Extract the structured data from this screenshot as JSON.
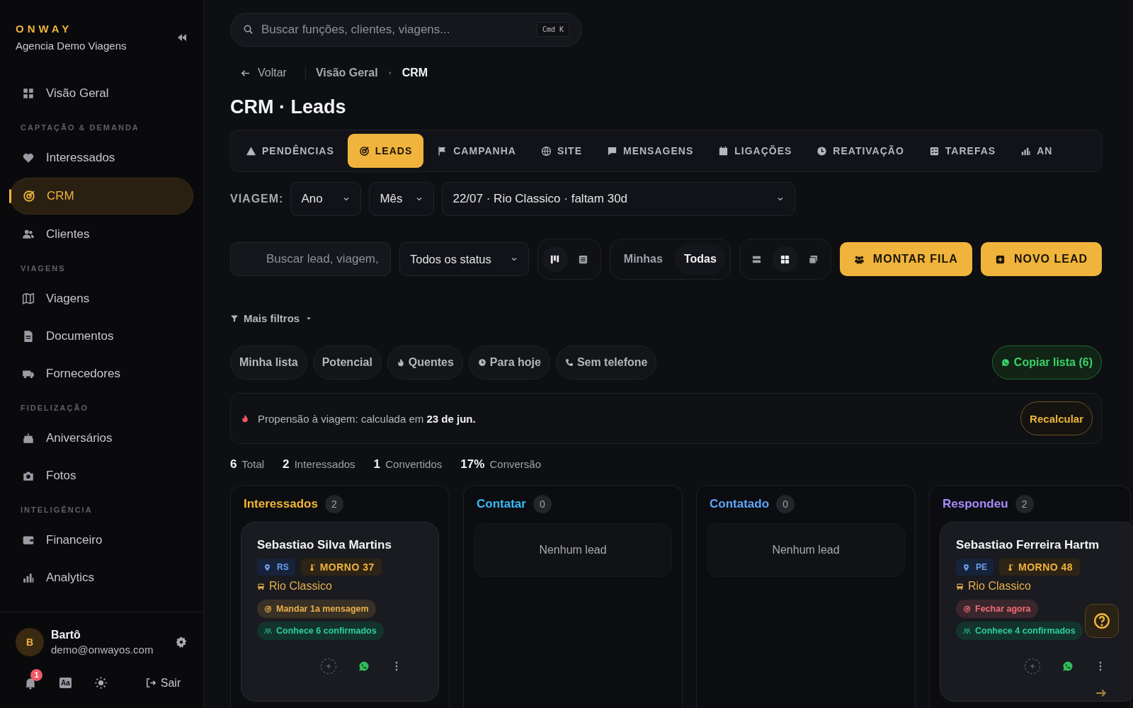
{
  "sidebar": {
    "brand": "ONWAY",
    "subtitle": "Agencia Demo Viagens",
    "nav": [
      {
        "kind": "item",
        "label": "Visão Geral",
        "selected": false
      },
      {
        "kind": "section",
        "label": "CAPTAÇÃO & DEMANDA"
      },
      {
        "kind": "item",
        "label": "Interessados",
        "selected": false
      },
      {
        "kind": "item",
        "label": "CRM",
        "selected": true
      },
      {
        "kind": "item",
        "label": "Clientes",
        "selected": false
      },
      {
        "kind": "section",
        "label": "VIAGENS"
      },
      {
        "kind": "item",
        "label": "Viagens",
        "selected": false
      },
      {
        "kind": "item",
        "label": "Documentos",
        "selected": false
      },
      {
        "kind": "item",
        "label": "Fornecedores",
        "selected": false
      },
      {
        "kind": "section",
        "label": "FIDELIZAÇÃO"
      },
      {
        "kind": "item",
        "label": "Aniversários",
        "selected": false
      },
      {
        "kind": "item",
        "label": "Fotos",
        "selected": false
      },
      {
        "kind": "section",
        "label": "INTELIGÊNCIA"
      },
      {
        "kind": "item",
        "label": "Financeiro",
        "selected": false
      },
      {
        "kind": "item",
        "label": "Analytics",
        "selected": false
      }
    ],
    "user": {
      "initial": "B",
      "name": "Bartô",
      "email": "demo@onwayos.com"
    },
    "notifications": "1",
    "font_button": "Aa",
    "logout": "Sair"
  },
  "search": {
    "placeholder": "Buscar funções, clientes, viagens...",
    "shortcut": "Cmd K"
  },
  "breadcrumb": {
    "back": "Voltar",
    "items": [
      "Visão Geral",
      "CRM"
    ]
  },
  "title": "CRM · Leads",
  "tabs": [
    {
      "label": "PENDÊNCIAS",
      "selected": false
    },
    {
      "label": "LEADS",
      "selected": true
    },
    {
      "label": "CAMPANHA",
      "selected": false
    },
    {
      "label": "SITE",
      "selected": false
    },
    {
      "label": "MENSAGENS",
      "selected": false
    },
    {
      "label": "LIGAÇÕES",
      "selected": false
    },
    {
      "label": "REATIVAÇÃO",
      "selected": false
    },
    {
      "label": "TAREFAS",
      "selected": false
    },
    {
      "label": "AN",
      "selected": false
    }
  ],
  "trip_filter": {
    "label": "VIAGEM:",
    "year": "Ano",
    "month": "Mês",
    "trip": "22/07 · Rio Classico · faltam 30d"
  },
  "toolbar": {
    "search_placeholder": "Buscar lead, viagem,",
    "status": "Todos os status",
    "view_modes": [
      {
        "selected": true
      },
      {
        "selected": false
      }
    ],
    "owners": [
      {
        "label": "Minhas",
        "selected": false
      },
      {
        "label": "Todas",
        "selected": true
      }
    ],
    "densities": [
      {
        "selected": false
      },
      {
        "selected": true
      },
      {
        "selected": false
      }
    ],
    "buttons": [
      "MONTAR FILA",
      "NOVO LEAD"
    ]
  },
  "more_filters": "Mais filtros",
  "chips": [
    {
      "label": "Minha lista",
      "selected": false
    },
    {
      "label": "Potencial",
      "selected": false
    },
    {
      "label": "Quentes",
      "selected": false
    },
    {
      "label": "Para hoje",
      "selected": false
    },
    {
      "label": "Sem telefone",
      "selected": false
    }
  ],
  "copy_list": "Copiar lista (6)",
  "propensity": {
    "text": "Propensão à viagem: calculada em **23 de jun.**",
    "button": "Recalcular"
  },
  "stats": [
    "**6** Total",
    "**2** Interessados",
    "**1** Convertidos",
    "**17%** Conversão"
  ],
  "columns": [
    {
      "title": "Interessados",
      "color": "#f5b731",
      "count": "2",
      "cards": [
        {
          "name": "Sebastiao Silva Martins",
          "state": "RS",
          "temperature": "MORNO 37",
          "trip": "Rio Classico",
          "action": {
            "text": "Mandar 1a mensagem",
            "color": "#e8b04a"
          },
          "network": "Conhece 6 confirmados"
        }
      ]
    },
    {
      "title": "Contatar",
      "color": "#38bdf8",
      "count": "0",
      "empty_text": "Nenhum lead"
    },
    {
      "title": "Contatado",
      "color": "#60a5fa",
      "count": "0",
      "empty_text": "Nenhum lead"
    },
    {
      "title": "Respondeu",
      "color": "#a78bfa",
      "count": "2",
      "cards": [
        {
          "name": "Sebastiao Ferreira Hartm",
          "state": "PE",
          "temperature": "MORNO 48",
          "trip": "Rio Classico",
          "action": {
            "text": "Fechar agora",
            "color": "#f06c78"
          },
          "network": "Conhece 4 confirmados"
        }
      ]
    }
  ]
}
